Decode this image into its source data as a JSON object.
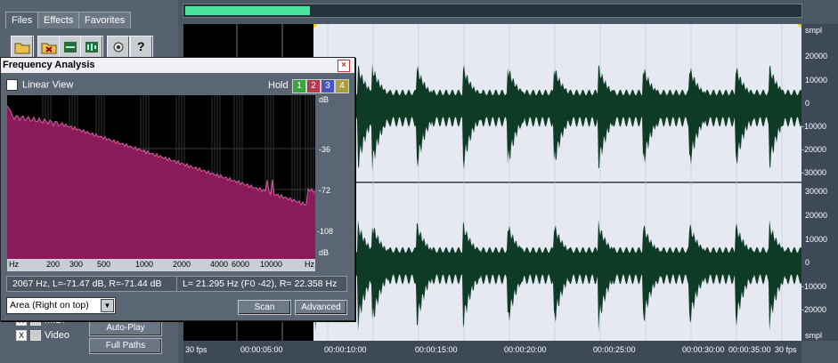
{
  "organizer": {
    "tabs": [
      "Files",
      "Effects",
      "Favorites"
    ],
    "toolbar_icons": [
      "open-folder-icon",
      "close-folder-icon",
      "insert-icon",
      "import-icon",
      "settings-icon",
      "help-icon"
    ],
    "help_glyph": "?",
    "filter_rows": [
      {
        "label": "MIDI",
        "checked": true
      },
      {
        "label": "Video",
        "checked": true
      }
    ],
    "checkmark": "X",
    "buttons": {
      "autoplay": "Auto-Play",
      "full_paths": "Full Paths"
    }
  },
  "waveform": {
    "amp_unit": "smpl",
    "top_channel_ticks": [
      "20000",
      "10000",
      "0",
      "-10000",
      "-20000",
      "-30000"
    ],
    "bottom_channel_ticks": [
      "30000",
      "20000",
      "10000",
      "0",
      "-10000",
      "-20000"
    ],
    "bottom_unit": "smpl",
    "time_labels": [
      "00:00:05:00",
      "00:00:10:00",
      "00:00:15:00",
      "00:00:20:00",
      "00:00:25:00",
      "00:00:30:00",
      "00:00:35:00"
    ],
    "fps_left": "30 fps",
    "fps_right": "30 fps",
    "colors": {
      "wave": "#0d3b26",
      "selection_bg": "#e6e8f2",
      "unselected_bg": "#000000",
      "overview": "#46e39a"
    }
  },
  "freq": {
    "title": "Frequency Analysis",
    "close_glyph": "×",
    "linear_view_label": "Linear View",
    "linear_view_checked": false,
    "hold_label": "Hold",
    "hold_buttons": [
      {
        "label": "1",
        "color": "#3aa340"
      },
      {
        "label": "2",
        "color": "#b43a52"
      },
      {
        "label": "3",
        "color": "#4a56b8"
      },
      {
        "label": "4",
        "color": "#a8a040"
      }
    ],
    "db_unit": "dB",
    "db_ticks": [
      "-36",
      "-72",
      "-108"
    ],
    "db_bottom": "dB",
    "hz_ticks": [
      "200",
      "300",
      "500",
      "1000",
      "2000",
      "4000",
      "6000",
      "10000"
    ],
    "hz_unit_left": "Hz",
    "hz_unit_right": "Hz",
    "readout_left": "2067 Hz, L=-71.47 dB, R=-71.44 dB",
    "readout_right": "L= 21.295 Hz (F0 -42), R= 22.358 Hz",
    "view_mode": "Area (Right on top)",
    "scan_label": "Scan",
    "advanced_label": "Advanced",
    "spectrum_color": "#8a1a5a"
  }
}
